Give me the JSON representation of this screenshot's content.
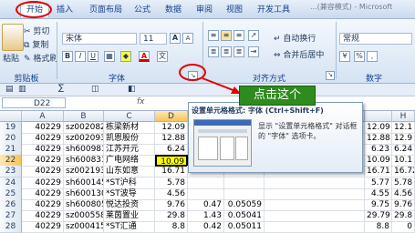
{
  "tabs": [
    "开始",
    "插入",
    "页面布局",
    "公式",
    "数据",
    "审阅",
    "视图",
    "开发工具"
  ],
  "window_title_fragment": "...(兼容模式) - Microsoft",
  "clipboard": {
    "paste": "粘贴",
    "cut": "剪切",
    "copy": "复制",
    "format_painter": "格式刷",
    "label": "剪贴板"
  },
  "font": {
    "name": "宋体",
    "size": "11",
    "bold": "B",
    "italic": "I",
    "underline": "U",
    "grow": "A",
    "shrink": "A",
    "font_color_glyph": "A",
    "phonetic": "文",
    "label": "字体"
  },
  "alignment": {
    "wrap": "自动换行",
    "merge": "合并后居中",
    "label": "对齐方式"
  },
  "number": {
    "format": "常规",
    "percent": "%",
    "comma": ",",
    "label": "数字"
  },
  "name_box": "D22",
  "fx": "fx",
  "columns": [
    "A",
    "B",
    "C",
    "D",
    "E",
    "F",
    "H"
  ],
  "rows": [
    {
      "n": "19",
      "a": "40229",
      "b": "sz002082",
      "c": "栋梁新材",
      "d": "12.09",
      "h": "12.09",
      "i": "12.1"
    },
    {
      "n": "20",
      "a": "40229",
      "b": "sz002093",
      "c": "凯恩股份",
      "d": "12.88",
      "h": "12.88",
      "i": "12.9"
    },
    {
      "n": "21",
      "a": "40229",
      "b": "sh600981",
      "c": "江苏开元",
      "d": "6.24",
      "h": "6.23",
      "i": "6.24"
    },
    {
      "n": "22",
      "a": "40229",
      "b": "sh600831",
      "c": "广电网络",
      "d": "10.09",
      "h": "10.09",
      "i": "10.1"
    },
    {
      "n": "23",
      "a": "40229",
      "b": "sz002193",
      "c": "山东如意",
      "d": "16.71",
      "h": "16.71",
      "i": "16.72"
    },
    {
      "n": "24",
      "a": "40229",
      "b": "sh600145",
      "c": "*ST沪科",
      "d": "5.78",
      "h": "5.77",
      "i": "5.78"
    },
    {
      "n": "25",
      "a": "40229",
      "b": "sh600130",
      "c": "*ST波导",
      "d": "4.56",
      "h": "4.55",
      "i": "4.56"
    },
    {
      "n": "26",
      "a": "40229",
      "b": "sh600805",
      "c": "悦达投资",
      "d": "9.76",
      "e": "0.47",
      "f": "0.05059",
      "h": "9.75",
      "i": "9.76"
    },
    {
      "n": "27",
      "a": "40229",
      "b": "sz000558",
      "c": "莱茵置业",
      "d": "29.8",
      "e": "1.43",
      "f": "0.05041",
      "h": "29.79",
      "i": "29.8"
    },
    {
      "n": "28",
      "a": "40229",
      "b": "sz000415",
      "c": "*ST汇通",
      "d": "8.8",
      "e": "0.42",
      "f": "0.05011",
      "h": "8.8",
      "i": "0"
    }
  ],
  "tooltip": {
    "title": "设置单元格格式: 字体 (Ctrl+Shift+F)",
    "body": "显示 \"设置单元格格式\" 对话框的 \"字体\" 选项卡。"
  },
  "callout": "点击这个",
  "colors": {
    "accent": "#15428b",
    "callout_green": "#2e8b1e",
    "highlight_red": "#e00000",
    "selected_cell": "#ffff00"
  }
}
